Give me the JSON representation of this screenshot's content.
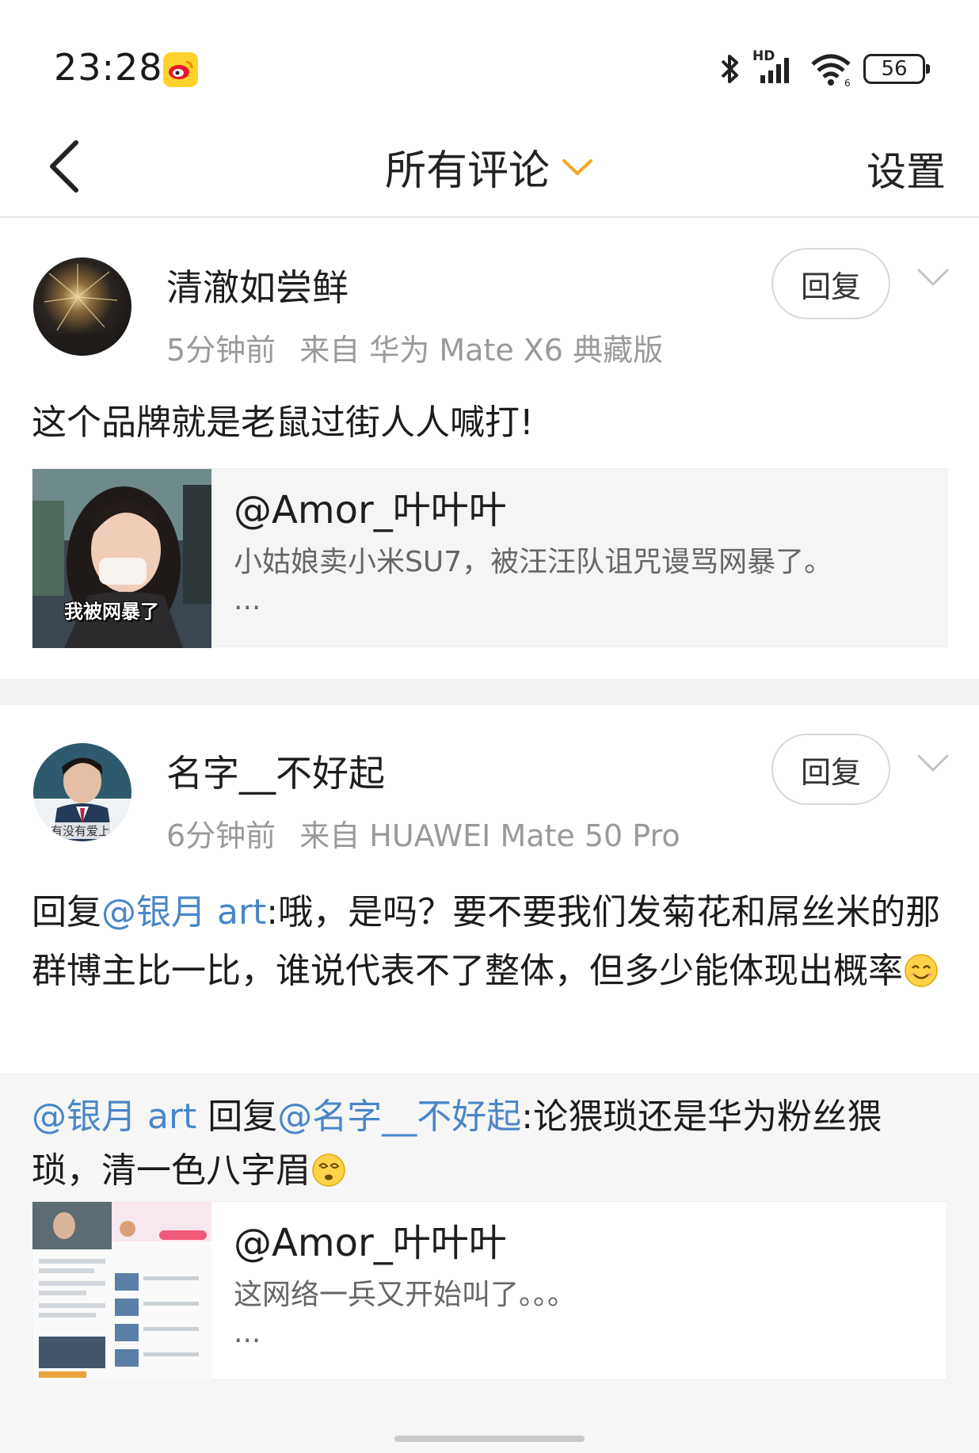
{
  "status_bar": {
    "time": "23:28",
    "app_icon": "weibo-icon",
    "network_label": "HD",
    "battery": "56",
    "icons": [
      "bluetooth-icon",
      "signal-icon",
      "wifi-icon",
      "battery-icon"
    ]
  },
  "nav": {
    "back_icon": "chevron-left-icon",
    "title": "所有评论",
    "title_icon": "chevron-down-icon",
    "settings_label": "设置"
  },
  "colors": {
    "mention": "#4a86c8",
    "title_chevron": "#f5a623",
    "weibo_badge": "#ffd22e"
  },
  "comments": [
    {
      "username": "清澈如尝鲜",
      "time": "5分钟前",
      "source": "来自 华为 Mate X6 典藏版",
      "reply_label": "回复",
      "text": "这个品牌就是老鼠过街人人喊打!",
      "share_card": {
        "author": "@Amor_叶叶叶",
        "desc": "小姑娘卖小米SU7，被汪汪队诅咒谩骂网暴了。",
        "ellipsis": "...",
        "thumb_caption": "我被网暴了"
      }
    },
    {
      "username": "名字__不好起",
      "time": "6分钟前",
      "source": "来自 HUAWEI Mate 50 Pro",
      "reply_label": "回复",
      "avatar_caption": "有没有爱上",
      "text_prefix": "回复",
      "text_mention": "@银月 art",
      "text_body": ":哦，是吗？要不要我们发菊花和屌丝米的那群博主比一比，谁说代表不了整体，但多少能体现出概率",
      "text_emoji": "smile-emoji-icon",
      "quote": {
        "mention_a": "@银月 art",
        "reply_word": " 回复",
        "mention_b": "@名字__不好起",
        "body": ":论猥琐还是华为粉丝猥琐，清一色八字眉",
        "emoji": "dizzy-emoji-icon",
        "share_card": {
          "author": "@Amor_叶叶叶",
          "desc": "这网络一兵又开始叫了。。。",
          "ellipsis": "..."
        }
      }
    }
  ]
}
